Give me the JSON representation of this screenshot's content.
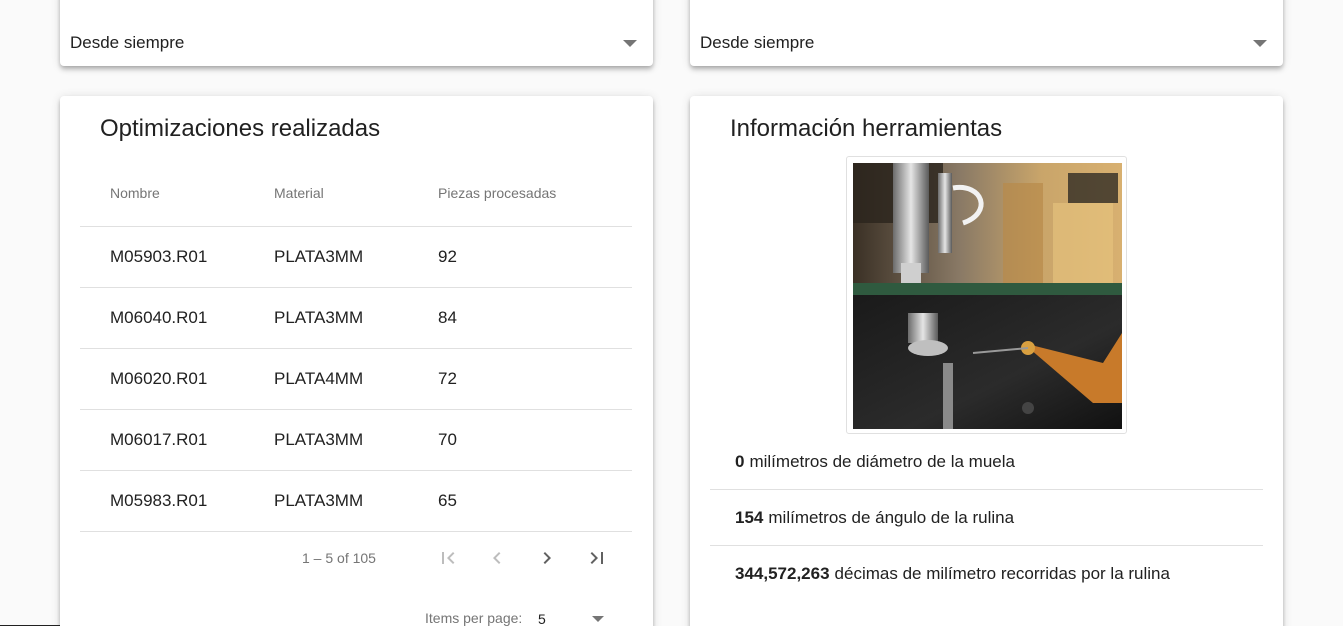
{
  "filters": {
    "left": {
      "selected": "Desde siempre"
    },
    "right": {
      "selected": "Desde siempre"
    }
  },
  "optimizations": {
    "title": "Optimizaciones realizadas",
    "columns": [
      "Nombre",
      "Material",
      "Piezas procesadas"
    ],
    "rows": [
      [
        "M05903.R01",
        "PLATA3MM",
        "92"
      ],
      [
        "M06040.R01",
        "PLATA3MM",
        "84"
      ],
      [
        "M06020.R01",
        "PLATA4MM",
        "72"
      ],
      [
        "M06017.R01",
        "PLATA3MM",
        "70"
      ],
      [
        "M05983.R01",
        "PLATA3MM",
        "65"
      ]
    ],
    "paginator": {
      "range": "1 – 5 of 105",
      "items_per_page_label": "Items per page:",
      "items_per_page": "5"
    }
  },
  "tools": {
    "title": "Información herramientas",
    "image_icon": "machine-tool-photo",
    "items": [
      {
        "value": "0",
        "text": "milímetros de diámetro de la muela"
      },
      {
        "value": "154",
        "text": "milímetros de ángulo de la rulina"
      },
      {
        "value": "344,572,263",
        "text": "décimas de milímetro recorridas por la rulina"
      }
    ]
  }
}
